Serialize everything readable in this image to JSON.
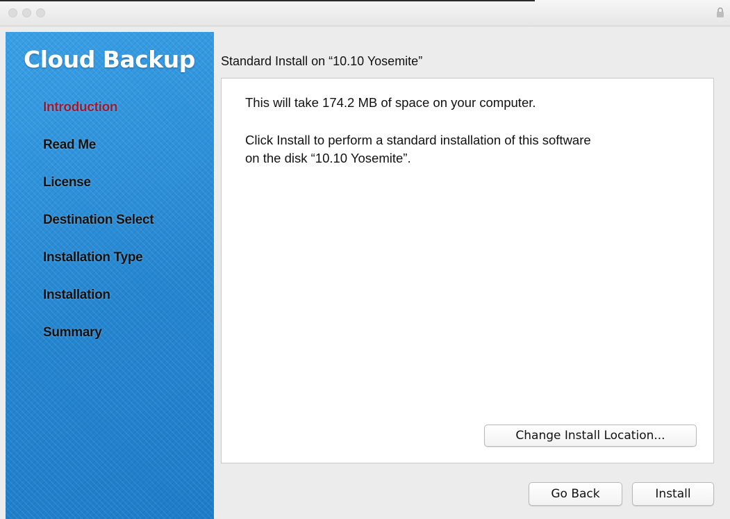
{
  "window": {
    "title": "",
    "traffic_lights": [
      "close",
      "minimize",
      "zoom"
    ],
    "lock_icon": "lock-icon"
  },
  "sidebar": {
    "brand": "Cloud Backup",
    "items": [
      {
        "label": "Introduction",
        "active": true
      },
      {
        "label": "Read Me",
        "active": false
      },
      {
        "label": "License",
        "active": false
      },
      {
        "label": "Destination Select",
        "active": false
      },
      {
        "label": "Installation Type",
        "active": false
      },
      {
        "label": "Installation",
        "active": false
      },
      {
        "label": "Summary",
        "active": false
      }
    ],
    "colors": {
      "background": "#2f8fd8",
      "active_text": "#9b1b2f",
      "text": "#111111"
    }
  },
  "main": {
    "heading": "Standard Install on “10.10 Yosemite”",
    "space_message": "This will take 174.2 MB of space on your computer.",
    "install_message_line1": "Click Install to perform a standard installation of this software",
    "install_message_line2": "on the disk “10.10 Yosemite”.",
    "change_location_label": "Change Install Location..."
  },
  "footer": {
    "go_back_label": "Go Back",
    "install_label": "Install"
  }
}
